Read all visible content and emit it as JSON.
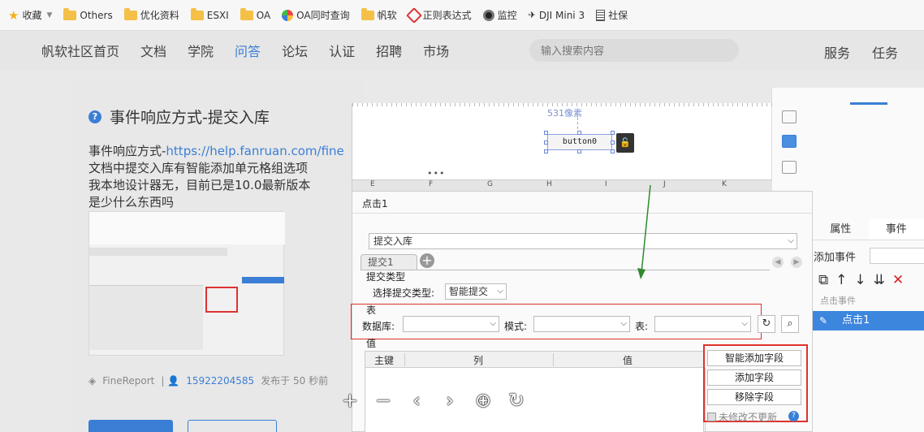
{
  "bookmarks": {
    "items": [
      {
        "label": "收藏",
        "icon": "star-icon"
      },
      {
        "label": "Others",
        "icon": "folder-icon"
      },
      {
        "label": "优化资料",
        "icon": "folder-icon"
      },
      {
        "label": "ESXI",
        "icon": "folder-icon"
      },
      {
        "label": "OA",
        "icon": "folder-icon"
      },
      {
        "label": "OA同时查询",
        "icon": "folder-icon"
      },
      {
        "label": "帆软",
        "icon": "folder-icon"
      },
      {
        "label": "正则表达式",
        "icon": "regex-icon"
      },
      {
        "label": "监控",
        "icon": "monitor-icon"
      },
      {
        "label": "DJI Mini 3",
        "icon": "dji-icon"
      },
      {
        "label": "社保",
        "icon": "doc-icon"
      }
    ]
  },
  "nav": {
    "items": [
      "帆软社区首页",
      "文档",
      "学院",
      "问答",
      "论坛",
      "认证",
      "招聘",
      "市场"
    ],
    "active": "问答",
    "search_placeholder": "输入搜索内容",
    "right": [
      "服务",
      "任务"
    ]
  },
  "question": {
    "title": "事件响应方式-提交入库",
    "body_line1_prefix": "事件响应方式-",
    "body_line1_link": "https://help.fanruan.com/fine",
    "body_line2": "文档中提交入库有智能添加单元格组选项",
    "body_line3": "我本地设计器无，目前已是10.0最新版本",
    "body_line4": "是少什么东西吗",
    "tag": "FineReport",
    "user": "15922204585",
    "time": "发布于 50 秒前"
  },
  "designer": {
    "pixel_label": "531像素",
    "button_label": "button0",
    "columns": [
      "E",
      "F",
      "G",
      "H",
      "I",
      "J",
      "K"
    ]
  },
  "events": {
    "tabs": [
      "属性",
      "事件"
    ],
    "active_tab": "事件",
    "add_event_label": "添加事件",
    "group_label": "点击事件",
    "selected_event": "点击1"
  },
  "dialog": {
    "title": "点击1",
    "action_select": "提交入库",
    "tab_label": "提交1",
    "submit_type_label": "提交类型",
    "choose_type_label": "选择提交类型:",
    "choose_type_value": "智能提交",
    "table_section_label": "表",
    "database_label": "数据库:",
    "database_value": "",
    "schema_label": "模式:",
    "schema_value": "",
    "table_label": "表:",
    "table_value": "",
    "value_section_label": "值",
    "grid_headers": [
      "主键",
      "列",
      "值"
    ],
    "side_buttons": [
      "智能添加字段",
      "添加字段",
      "移除字段"
    ],
    "no_update_label": "未修改不更新"
  },
  "colors": {
    "accent": "#3b7ed6",
    "highlight_red": "#e0312b",
    "arrow_green": "#2e8b2e"
  }
}
